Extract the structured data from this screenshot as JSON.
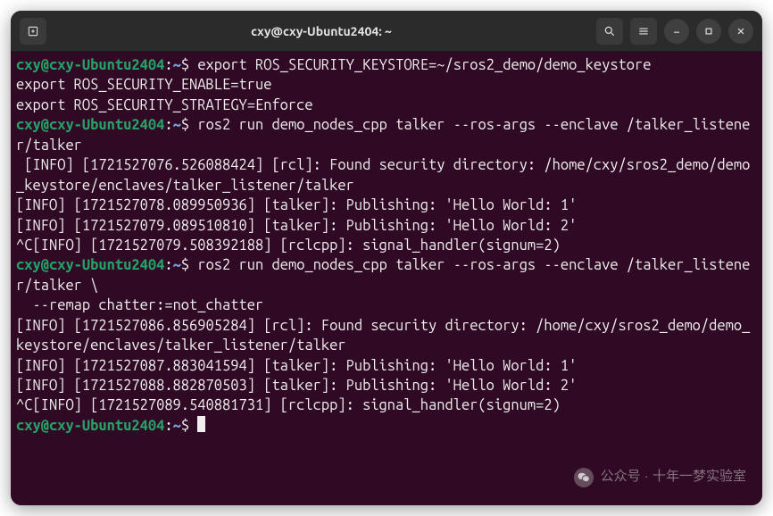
{
  "window": {
    "title": "cxy@cxy-Ubuntu2404: ~"
  },
  "prompt": {
    "user_host": "cxy@cxy-Ubuntu2404",
    "colon": ":",
    "path": "~",
    "sigil": "$"
  },
  "lines": {
    "cmd1": "export ROS_SECURITY_KEYSTORE=~/sros2_demo/demo_keystore",
    "out1a": "export ROS_SECURITY_ENABLE=true",
    "out1b": "export ROS_SECURITY_STRATEGY=Enforce",
    "cmd2": "ros2 run demo_nodes_cpp talker --ros-args --enclave /talker_listener/talker",
    "out2a": " [INFO] [1721527076.526088424] [rcl]: Found security directory: /home/cxy/sros2_demo/demo_keystore/enclaves/talker_listener/talker",
    "out2b": "[INFO] [1721527078.089950936] [talker]: Publishing: 'Hello World: 1'",
    "out2c": "[INFO] [1721527079.089510810] [talker]: Publishing: 'Hello World: 2'",
    "out2d": "^C[INFO] [1721527079.508392188] [rclcpp]: signal_handler(signum=2)",
    "cmd3a": "ros2 run demo_nodes_cpp talker --ros-args --enclave /talker_listener/talker \\",
    "cmd3b": "  --remap chatter:=not_chatter",
    "out3a": "[INFO] [1721527086.856905284] [rcl]: Found security directory: /home/cxy/sros2_demo/demo_keystore/enclaves/talker_listener/talker",
    "out3b": "[INFO] [1721527087.883041594] [talker]: Publishing: 'Hello World: 1'",
    "out3c": "[INFO] [1721527088.882870503] [talker]: Publishing: 'Hello World: 2'",
    "out3d": "^C[INFO] [1721527089.540881731] [rclcpp]: signal_handler(signum=2)"
  },
  "watermark": {
    "prefix": "公众号 · ",
    "text": "十年一梦实验室"
  }
}
